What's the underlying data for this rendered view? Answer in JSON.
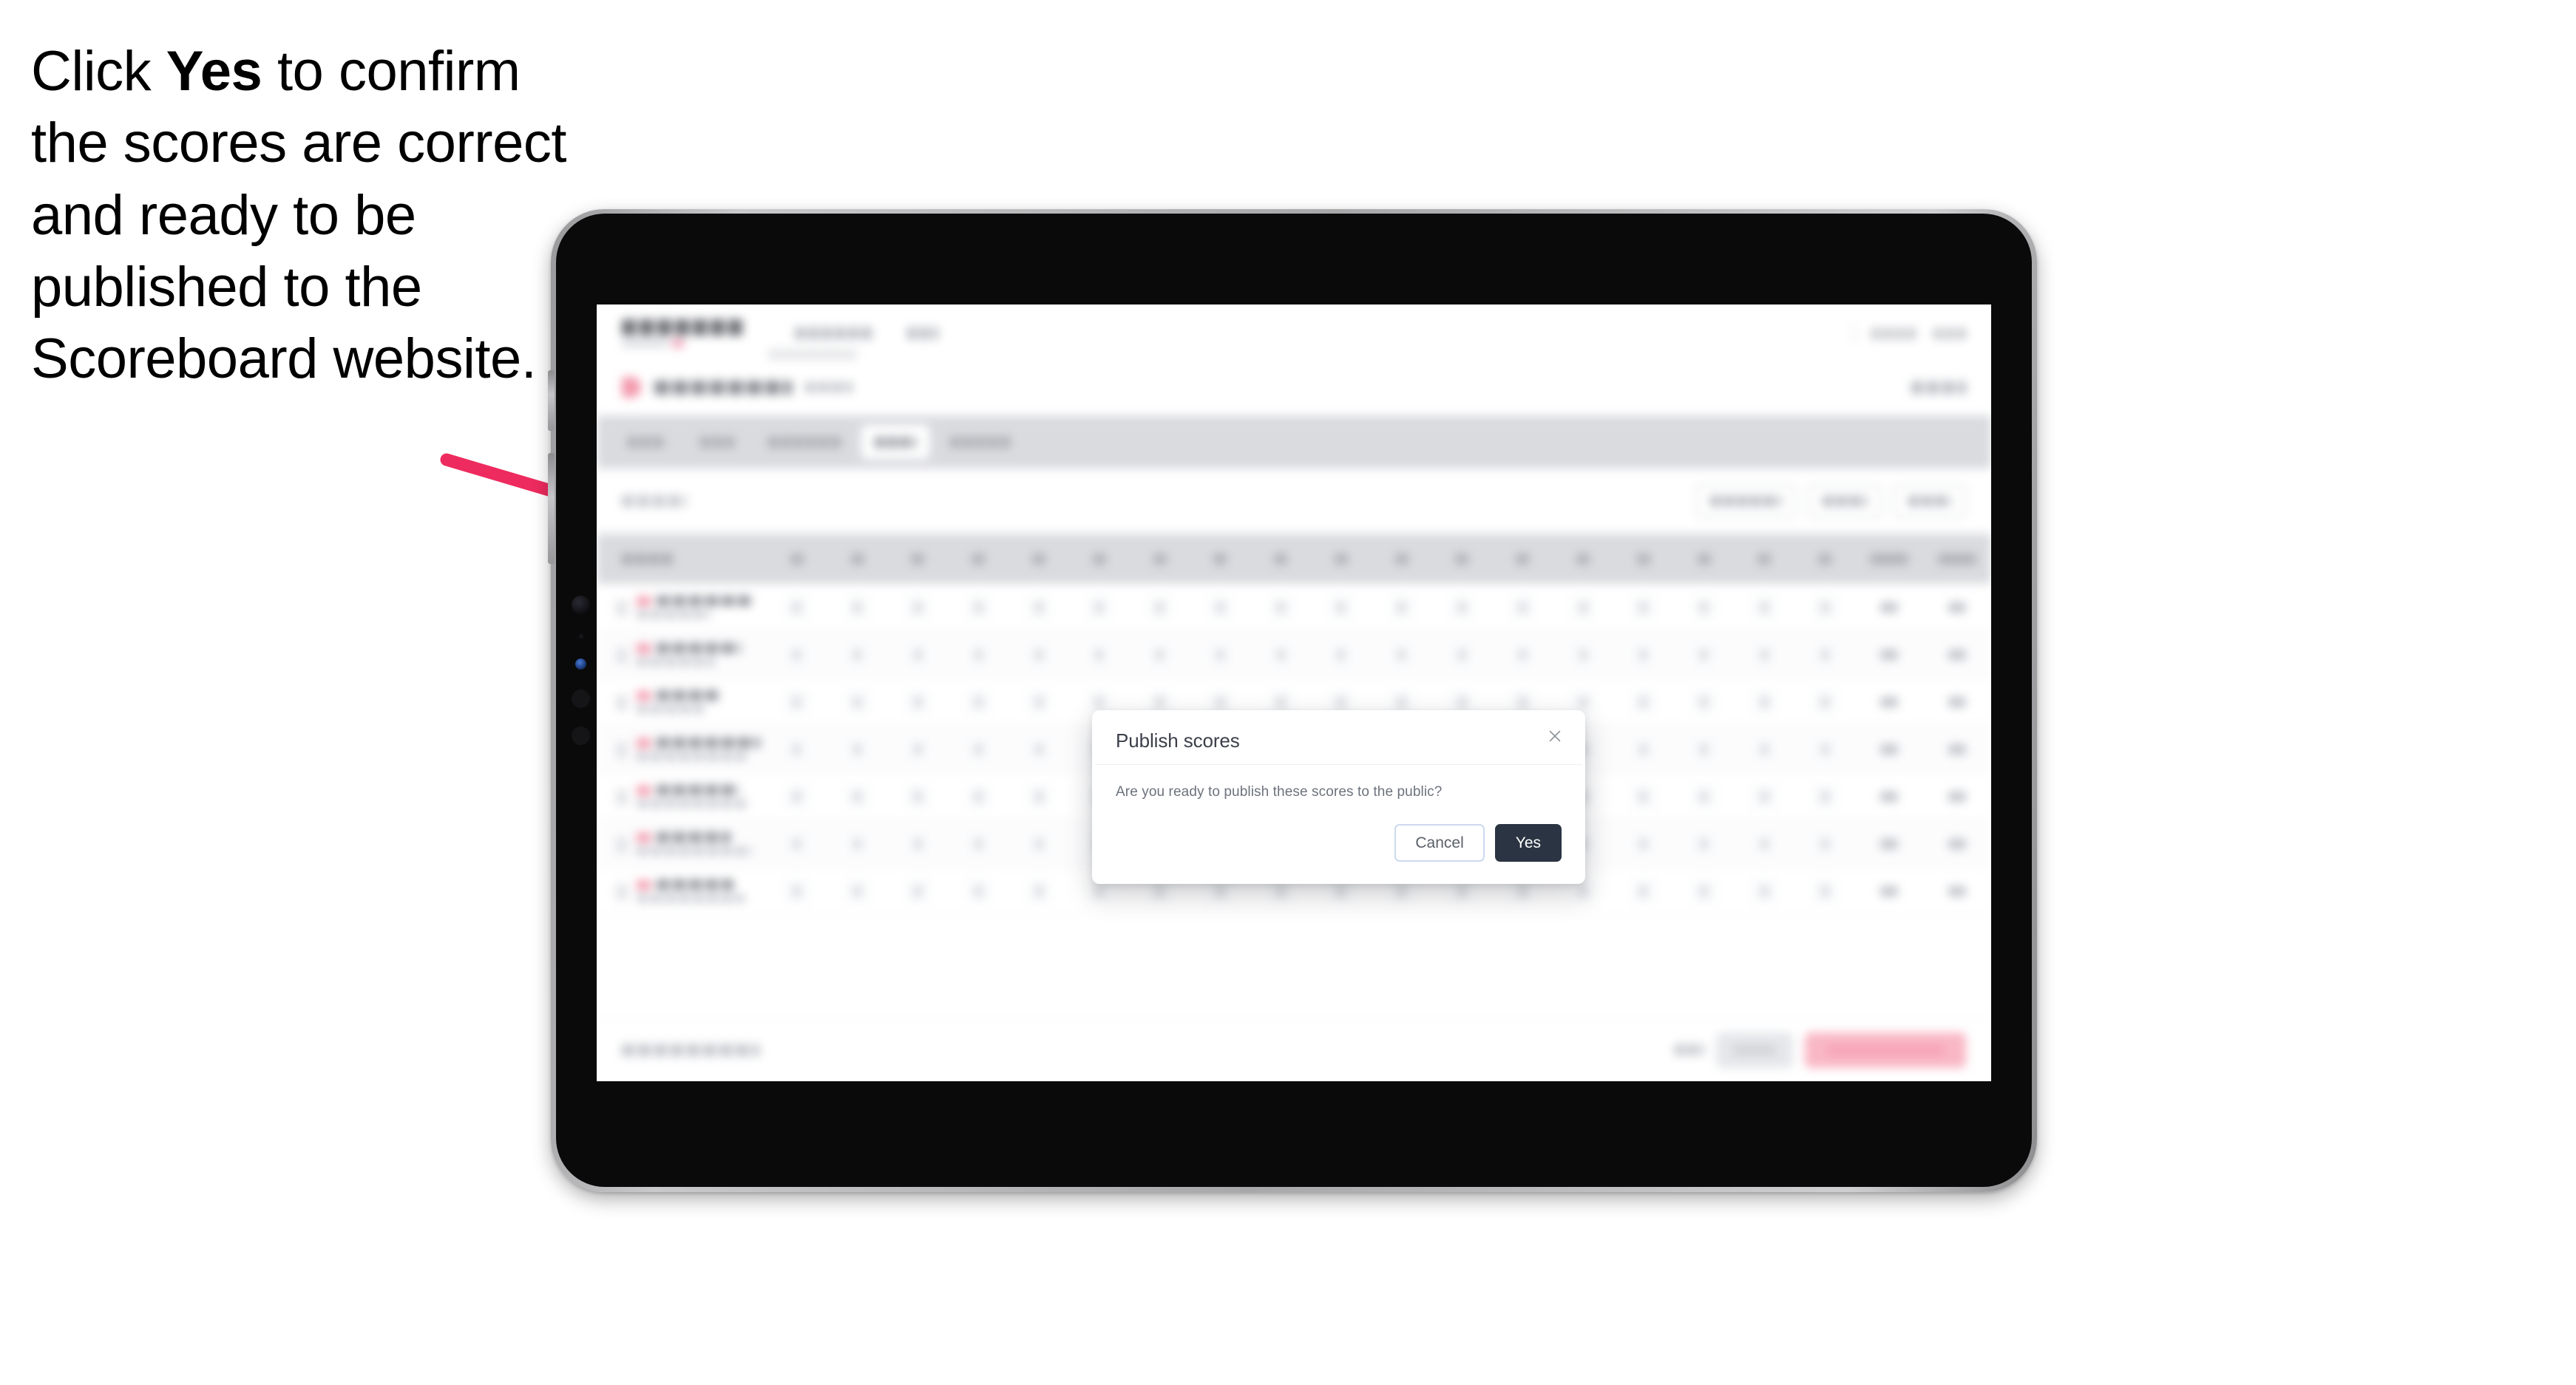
{
  "caption": {
    "line_prefix": "Click ",
    "emphasis": "Yes",
    "line_suffix": " to confirm the scores are correct and ready to be published to the Scoreboard website."
  },
  "annotation": {
    "arrow_color": "#ED2B5E",
    "arrow_name": "pointer-arrow"
  },
  "device": {
    "type": "tablet",
    "frame_color": "#0a0a0a",
    "bezel_color": "#b8b8ba"
  },
  "dialog": {
    "title": "Publish scores",
    "message": "Are you ready to publish these scores to the public?",
    "close_label": "×",
    "cancel_label": "Cancel",
    "confirm_label": "Yes",
    "confirm_bg": "#2b3442",
    "cancel_border": "#ccd9ef"
  },
  "app": {
    "tabs_count": 5,
    "active_tab_index": 3,
    "score_columns": 18,
    "player_rows": 7,
    "accent_color": "#f39aae",
    "tab_bar_bg": "#d9dbdf",
    "publish_button_bg": "#f9b7c5"
  }
}
